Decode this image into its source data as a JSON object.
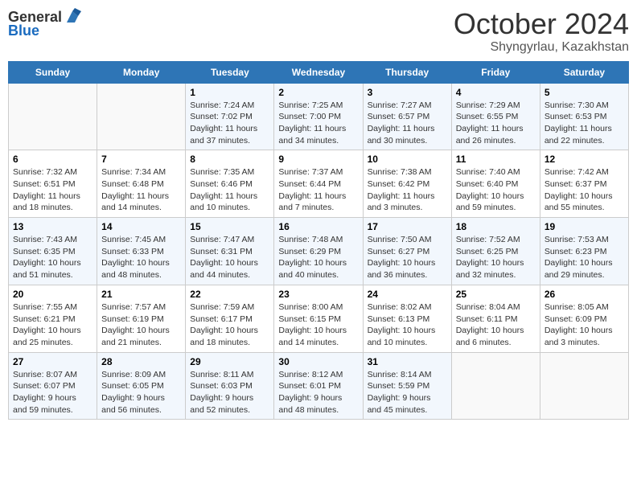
{
  "logo": {
    "text_general": "General",
    "text_blue": "Blue"
  },
  "title": "October 2024",
  "subtitle": "Shyngyrlau, Kazakhstan",
  "weekdays": [
    "Sunday",
    "Monday",
    "Tuesday",
    "Wednesday",
    "Thursday",
    "Friday",
    "Saturday"
  ],
  "weeks": [
    [
      {
        "day": "",
        "sunrise": "",
        "sunset": "",
        "daylight": ""
      },
      {
        "day": "",
        "sunrise": "",
        "sunset": "",
        "daylight": ""
      },
      {
        "day": "1",
        "sunrise": "Sunrise: 7:24 AM",
        "sunset": "Sunset: 7:02 PM",
        "daylight": "Daylight: 11 hours and 37 minutes."
      },
      {
        "day": "2",
        "sunrise": "Sunrise: 7:25 AM",
        "sunset": "Sunset: 7:00 PM",
        "daylight": "Daylight: 11 hours and 34 minutes."
      },
      {
        "day": "3",
        "sunrise": "Sunrise: 7:27 AM",
        "sunset": "Sunset: 6:57 PM",
        "daylight": "Daylight: 11 hours and 30 minutes."
      },
      {
        "day": "4",
        "sunrise": "Sunrise: 7:29 AM",
        "sunset": "Sunset: 6:55 PM",
        "daylight": "Daylight: 11 hours and 26 minutes."
      },
      {
        "day": "5",
        "sunrise": "Sunrise: 7:30 AM",
        "sunset": "Sunset: 6:53 PM",
        "daylight": "Daylight: 11 hours and 22 minutes."
      }
    ],
    [
      {
        "day": "6",
        "sunrise": "Sunrise: 7:32 AM",
        "sunset": "Sunset: 6:51 PM",
        "daylight": "Daylight: 11 hours and 18 minutes."
      },
      {
        "day": "7",
        "sunrise": "Sunrise: 7:34 AM",
        "sunset": "Sunset: 6:48 PM",
        "daylight": "Daylight: 11 hours and 14 minutes."
      },
      {
        "day": "8",
        "sunrise": "Sunrise: 7:35 AM",
        "sunset": "Sunset: 6:46 PM",
        "daylight": "Daylight: 11 hours and 10 minutes."
      },
      {
        "day": "9",
        "sunrise": "Sunrise: 7:37 AM",
        "sunset": "Sunset: 6:44 PM",
        "daylight": "Daylight: 11 hours and 7 minutes."
      },
      {
        "day": "10",
        "sunrise": "Sunrise: 7:38 AM",
        "sunset": "Sunset: 6:42 PM",
        "daylight": "Daylight: 11 hours and 3 minutes."
      },
      {
        "day": "11",
        "sunrise": "Sunrise: 7:40 AM",
        "sunset": "Sunset: 6:40 PM",
        "daylight": "Daylight: 10 hours and 59 minutes."
      },
      {
        "day": "12",
        "sunrise": "Sunrise: 7:42 AM",
        "sunset": "Sunset: 6:37 PM",
        "daylight": "Daylight: 10 hours and 55 minutes."
      }
    ],
    [
      {
        "day": "13",
        "sunrise": "Sunrise: 7:43 AM",
        "sunset": "Sunset: 6:35 PM",
        "daylight": "Daylight: 10 hours and 51 minutes."
      },
      {
        "day": "14",
        "sunrise": "Sunrise: 7:45 AM",
        "sunset": "Sunset: 6:33 PM",
        "daylight": "Daylight: 10 hours and 48 minutes."
      },
      {
        "day": "15",
        "sunrise": "Sunrise: 7:47 AM",
        "sunset": "Sunset: 6:31 PM",
        "daylight": "Daylight: 10 hours and 44 minutes."
      },
      {
        "day": "16",
        "sunrise": "Sunrise: 7:48 AM",
        "sunset": "Sunset: 6:29 PM",
        "daylight": "Daylight: 10 hours and 40 minutes."
      },
      {
        "day": "17",
        "sunrise": "Sunrise: 7:50 AM",
        "sunset": "Sunset: 6:27 PM",
        "daylight": "Daylight: 10 hours and 36 minutes."
      },
      {
        "day": "18",
        "sunrise": "Sunrise: 7:52 AM",
        "sunset": "Sunset: 6:25 PM",
        "daylight": "Daylight: 10 hours and 32 minutes."
      },
      {
        "day": "19",
        "sunrise": "Sunrise: 7:53 AM",
        "sunset": "Sunset: 6:23 PM",
        "daylight": "Daylight: 10 hours and 29 minutes."
      }
    ],
    [
      {
        "day": "20",
        "sunrise": "Sunrise: 7:55 AM",
        "sunset": "Sunset: 6:21 PM",
        "daylight": "Daylight: 10 hours and 25 minutes."
      },
      {
        "day": "21",
        "sunrise": "Sunrise: 7:57 AM",
        "sunset": "Sunset: 6:19 PM",
        "daylight": "Daylight: 10 hours and 21 minutes."
      },
      {
        "day": "22",
        "sunrise": "Sunrise: 7:59 AM",
        "sunset": "Sunset: 6:17 PM",
        "daylight": "Daylight: 10 hours and 18 minutes."
      },
      {
        "day": "23",
        "sunrise": "Sunrise: 8:00 AM",
        "sunset": "Sunset: 6:15 PM",
        "daylight": "Daylight: 10 hours and 14 minutes."
      },
      {
        "day": "24",
        "sunrise": "Sunrise: 8:02 AM",
        "sunset": "Sunset: 6:13 PM",
        "daylight": "Daylight: 10 hours and 10 minutes."
      },
      {
        "day": "25",
        "sunrise": "Sunrise: 8:04 AM",
        "sunset": "Sunset: 6:11 PM",
        "daylight": "Daylight: 10 hours and 6 minutes."
      },
      {
        "day": "26",
        "sunrise": "Sunrise: 8:05 AM",
        "sunset": "Sunset: 6:09 PM",
        "daylight": "Daylight: 10 hours and 3 minutes."
      }
    ],
    [
      {
        "day": "27",
        "sunrise": "Sunrise: 8:07 AM",
        "sunset": "Sunset: 6:07 PM",
        "daylight": "Daylight: 9 hours and 59 minutes."
      },
      {
        "day": "28",
        "sunrise": "Sunrise: 8:09 AM",
        "sunset": "Sunset: 6:05 PM",
        "daylight": "Daylight: 9 hours and 56 minutes."
      },
      {
        "day": "29",
        "sunrise": "Sunrise: 8:11 AM",
        "sunset": "Sunset: 6:03 PM",
        "daylight": "Daylight: 9 hours and 52 minutes."
      },
      {
        "day": "30",
        "sunrise": "Sunrise: 8:12 AM",
        "sunset": "Sunset: 6:01 PM",
        "daylight": "Daylight: 9 hours and 48 minutes."
      },
      {
        "day": "31",
        "sunrise": "Sunrise: 8:14 AM",
        "sunset": "Sunset: 5:59 PM",
        "daylight": "Daylight: 9 hours and 45 minutes."
      },
      {
        "day": "",
        "sunrise": "",
        "sunset": "",
        "daylight": ""
      },
      {
        "day": "",
        "sunrise": "",
        "sunset": "",
        "daylight": ""
      }
    ]
  ]
}
